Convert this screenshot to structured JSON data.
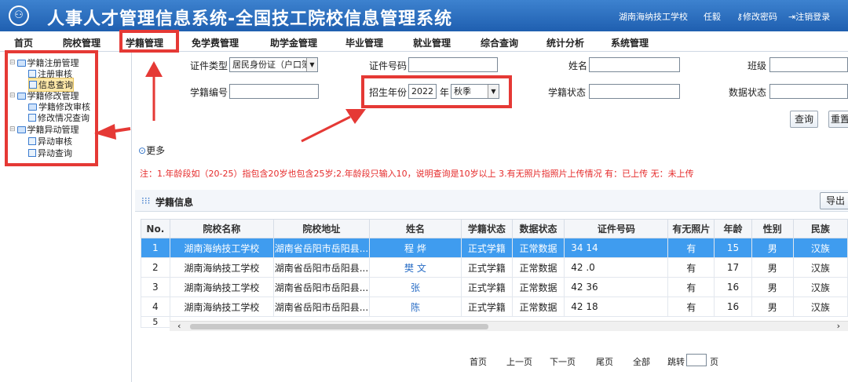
{
  "header": {
    "logo": "⚇",
    "title": "人事人才管理信息系统-全国技工院校信息管理系统",
    "school": "湖南海纳技工学校",
    "user": "任毅",
    "change_pwd": "修改密码",
    "logout": "注销登录"
  },
  "nav": [
    "首页",
    "院校管理",
    "学籍管理",
    "免学费管理",
    "助学金管理",
    "毕业管理",
    "就业管理",
    "综合查询",
    "统计分析",
    "系统管理"
  ],
  "tree": [
    {
      "label": "学籍注册管理"
    },
    {
      "label": "注册审核"
    },
    {
      "label": "信息查询"
    },
    {
      "label": "学籍修改管理"
    },
    {
      "label": "学籍修改审核"
    },
    {
      "label": "修改情况查询"
    },
    {
      "label": "学籍异动管理"
    },
    {
      "label": "异动审核"
    },
    {
      "label": "异动查询"
    }
  ],
  "form": {
    "id_type_label": "证件类型",
    "id_type_value": "居民身份证（户口簿",
    "id_no_label": "证件号码",
    "name_label": "姓名",
    "class_label": "班级",
    "student_no_label": "学籍编号",
    "enroll_year_label": "招生年份",
    "enroll_year_value": "2022",
    "year_unit": "年",
    "season_value": "秋季",
    "status_label": "学籍状态",
    "data_status_label": "数据状态",
    "query_button": "查询",
    "reset_button": "重置",
    "more_label": "更多"
  },
  "note": "注：1.年龄段如（20-25）指包含20岁也包含25岁;2.年龄段只输入10，说明查询是10岁以上 3.有无照片指照片上传情况 有：已上传 无：未上传",
  "panel": {
    "title": "学籍信息",
    "export_button": "导出"
  },
  "table": {
    "columns": [
      "No.",
      "院校名称",
      "院校地址",
      "姓名",
      "学籍状态",
      "数据状态",
      "证件号码",
      "有无照片",
      "年龄",
      "性别",
      "民族"
    ],
    "rows": [
      {
        "no": "1",
        "school": "湖南海纳技工学校",
        "addr": "湖南省岳阳市岳阳县...",
        "name": "程  烨",
        "status": "正式学籍",
        "data": "正常数据",
        "id": "34                    14",
        "photo": "有",
        "age": "15",
        "sex": "男",
        "eth": "汉族"
      },
      {
        "no": "2",
        "school": "湖南海纳技工学校",
        "addr": "湖南省岳阳市岳阳县...",
        "name": "樊  文",
        "status": "正式学籍",
        "data": "正常数据",
        "id": "42                    .0",
        "photo": "有",
        "age": "17",
        "sex": "男",
        "eth": "汉族"
      },
      {
        "no": "3",
        "school": "湖南海纳技工学校",
        "addr": "湖南省岳阳市岳阳县...",
        "name": "张",
        "status": "正式学籍",
        "data": "正常数据",
        "id": "42                    36",
        "photo": "有",
        "age": "16",
        "sex": "男",
        "eth": "汉族"
      },
      {
        "no": "4",
        "school": "湖南海纳技工学校",
        "addr": "湖南省岳阳市岳阳县...",
        "name": "陈",
        "status": "正式学籍",
        "data": "正常数据",
        "id": "42                    18",
        "photo": "有",
        "age": "16",
        "sex": "男",
        "eth": "汉族"
      }
    ],
    "partial_row": "5"
  },
  "pager": {
    "first": "首页",
    "prev": "上一页",
    "next": "下一页",
    "last": "尾页",
    "all": "全部",
    "jump": "跳转",
    "page_unit": "页"
  }
}
